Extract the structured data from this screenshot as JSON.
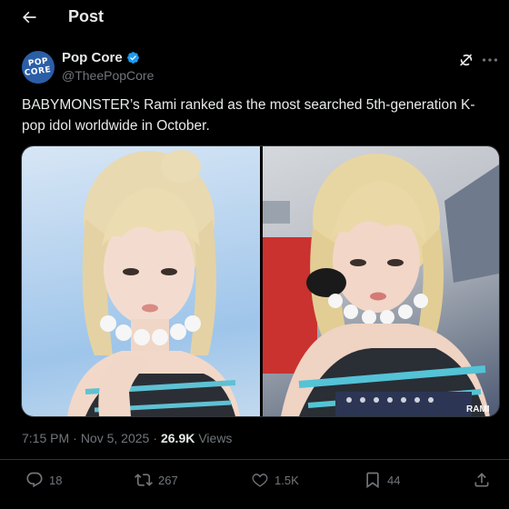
{
  "header": {
    "title": "Post"
  },
  "author": {
    "display_name": "Pop Core",
    "handle": "@TheePopCore",
    "avatar_text_line1": "POP",
    "avatar_text_line2": "CORE"
  },
  "tweet": {
    "text": "BABYMONSTER’s Rami ranked as the most searched 5th-generation K-pop idol worldwide in October."
  },
  "media": {
    "image_right_caption": "RAMI"
  },
  "meta": {
    "time": "7:15 PM",
    "separator": "·",
    "date": "Nov 5, 2025",
    "views_count": "26.9K",
    "views_label": "Views"
  },
  "actions": {
    "replies": "18",
    "reposts": "267",
    "likes": "1.5K",
    "bookmarks": "44"
  },
  "colors": {
    "background": "#000000",
    "text": "#e7e9ea",
    "muted": "#71767b",
    "accent": "#1d9bf0"
  }
}
